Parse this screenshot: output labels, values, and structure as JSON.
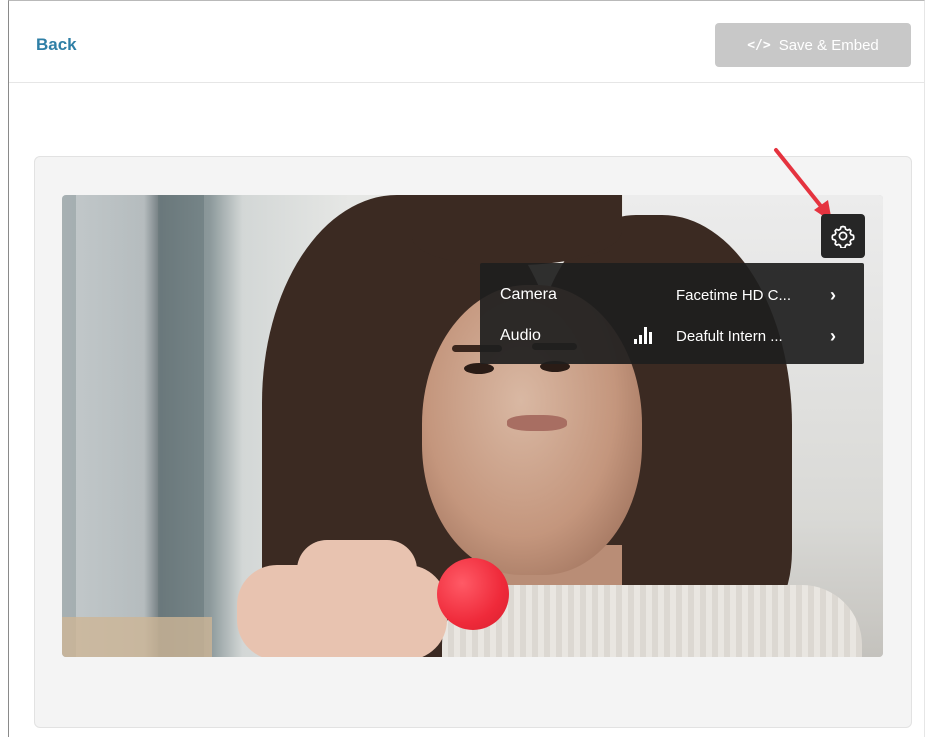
{
  "header": {
    "back_label": "Back",
    "save_icon": "</>",
    "save_label": "Save & Embed"
  },
  "settings_menu": {
    "camera": {
      "label": "Camera",
      "value": "Facetime HD C...",
      "chevron": "›"
    },
    "audio": {
      "label": "Audio",
      "value": "Deafult Intern ...",
      "chevron": "›"
    }
  },
  "icons": {
    "gear": "gear-icon",
    "audio_level": "audio-level-icon",
    "arrow": "red-arrow-annotation"
  },
  "colors": {
    "link": "#2f7fa6",
    "save_button_disabled": "#c8c8c8",
    "record": "#ef2a3a",
    "annotation_arrow": "#e5333f"
  }
}
